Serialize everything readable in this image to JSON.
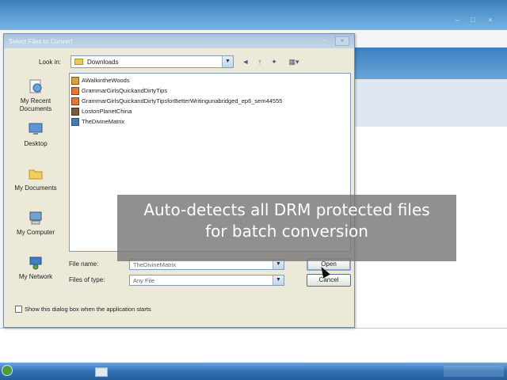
{
  "dialog": {
    "title": "Select Files to Convert",
    "close_label": "×",
    "minimize_label": "–",
    "look_in_label": "Look in:",
    "look_in_value": "Downloads",
    "places": [
      {
        "label": "My Recent Documents",
        "icon": "recent-documents-icon"
      },
      {
        "label": "Desktop",
        "icon": "desktop-icon"
      },
      {
        "label": "My Documents",
        "icon": "my-documents-icon"
      },
      {
        "label": "My Computer",
        "icon": "my-computer-icon"
      },
      {
        "label": "My Network",
        "icon": "my-network-icon"
      }
    ],
    "files": [
      {
        "name": "AWalkintheWoods",
        "icon": "audiobook-icon"
      },
      {
        "name": "GrammarGirlsQuickandDirtyTips",
        "icon": "audiobook-icon"
      },
      {
        "name": "GrammarGirlsQuickandDirtyTipsforBetterWritingunabridged_ep6_sem44555",
        "icon": "audiobook-icon"
      },
      {
        "name": "LostonPlanetChina",
        "icon": "audiobook-icon"
      },
      {
        "name": "TheDivineMatrix",
        "icon": "audiobook-icon"
      }
    ],
    "file_name_label": "File name:",
    "file_name_value": "TheDivineMatrix",
    "files_of_type_label": "Files of type:",
    "files_of_type_value": "Any File",
    "open_label": "Open",
    "cancel_label": "Cancel",
    "show_dialog_label": "Show this dialog box when the application starts"
  },
  "caption": {
    "line1": "Auto-detects all DRM protected files",
    "line2": "for batch conversion"
  },
  "colors": {
    "dialog_bg": "#ece9d8",
    "caption_bg": "#787878",
    "titlebar": "#3d7fbd"
  }
}
